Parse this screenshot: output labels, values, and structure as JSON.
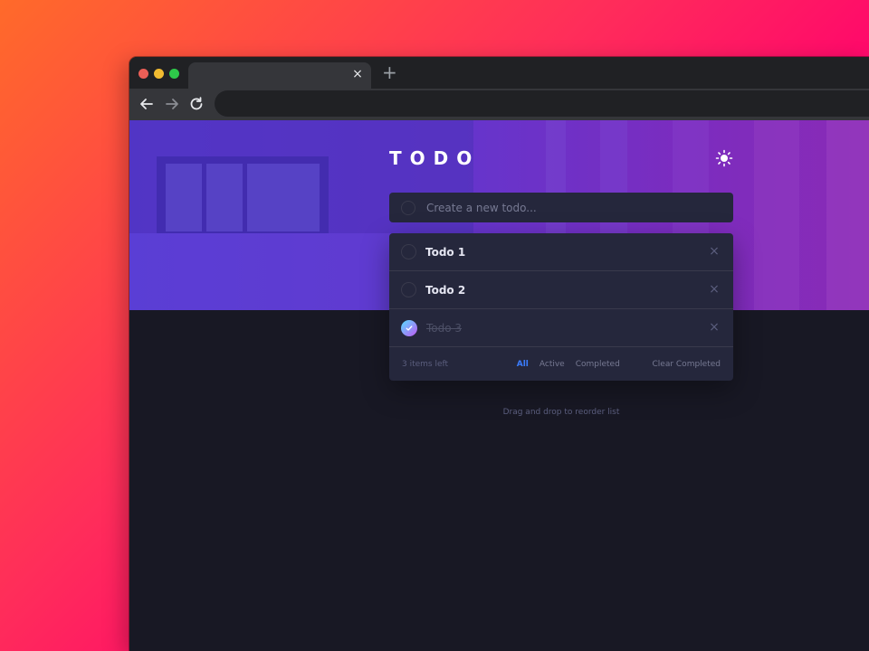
{
  "browser": {
    "tab_close": "×",
    "new_tab": "+"
  },
  "app": {
    "title": "TODO",
    "new_todo_placeholder": "Create a new todo...",
    "items": [
      {
        "label": "Todo 1",
        "completed": false
      },
      {
        "label": "Todo 2",
        "completed": false
      },
      {
        "label": "Todo 3",
        "completed": true
      }
    ],
    "delete_symbol": "×",
    "footer": {
      "items_left": "3 items left",
      "filter_all": "All",
      "filter_active": "Active",
      "filter_completed": "Completed",
      "clear_completed": "Clear Completed",
      "active_filter": "All"
    },
    "hint": "Drag and drop to reorder list"
  },
  "colors": {
    "accent": "#3a7cfd",
    "check_gradient_start": "#57ddff",
    "check_gradient_end": "#c058f3",
    "card": "#25273c",
    "page_bg": "#181824"
  },
  "icons": {
    "traffic_lights": [
      "close-dot",
      "minimize-dot",
      "maximize-dot"
    ],
    "nav": [
      "back-arrow-icon",
      "forward-arrow-icon",
      "reload-icon"
    ],
    "theme": "sun-icon"
  }
}
